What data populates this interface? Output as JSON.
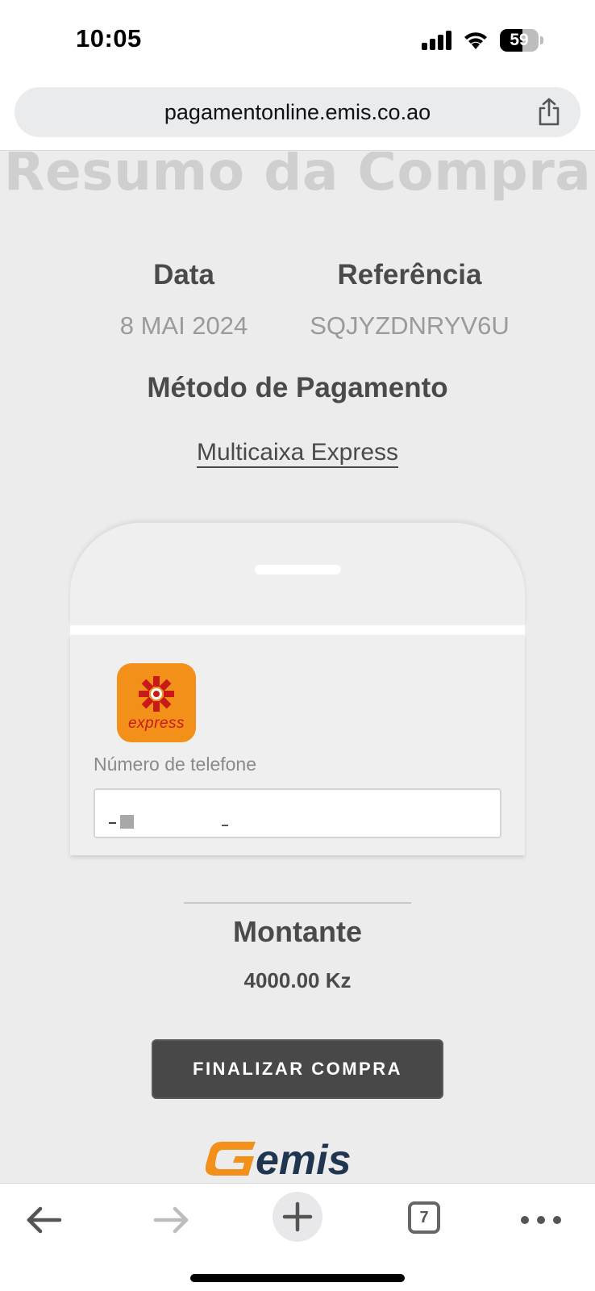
{
  "status_bar": {
    "time": "10:05",
    "battery_level": "59"
  },
  "browser": {
    "url": "pagamentonline.emis.co.ao",
    "open_tabs": "7"
  },
  "page": {
    "heading": "Resumo da Compra",
    "date_label": "Data",
    "date_value": "8 MAI 2024",
    "reference_label": "Referência",
    "reference_value": "SQJYZDNRYV6U",
    "payment_method_label": "Método de Pagamento",
    "payment_method_value": "Multicaixa Express",
    "express_logo_text": "express",
    "phone_label": "Número de telefone",
    "phone_value": "",
    "amount_label": "Montante",
    "amount_value": "4000.00 Kz",
    "finish_button": "FINALIZAR COMPRA",
    "footer_logo_text": "emis"
  },
  "colors": {
    "accent_orange": "#f39019",
    "express_red": "#c91a1a",
    "emis_navy": "#1f3550",
    "button_dark": "#484848"
  }
}
